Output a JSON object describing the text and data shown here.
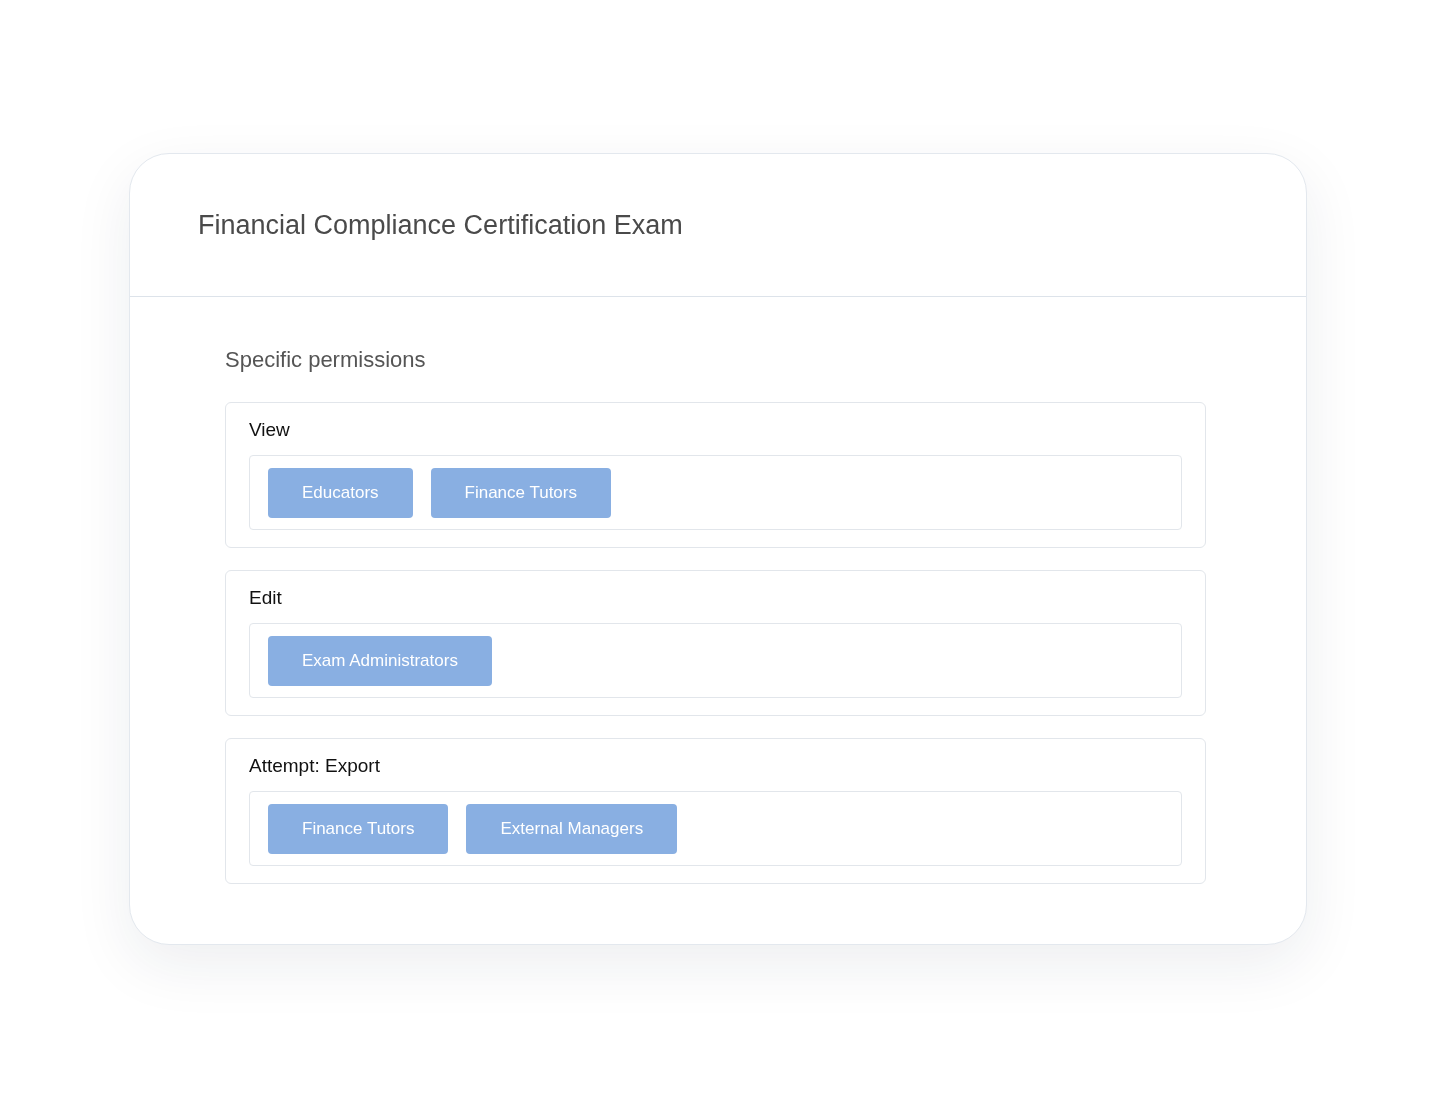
{
  "card": {
    "title": "Financial Compliance Certification Exam"
  },
  "permissions": {
    "heading": "Specific permissions",
    "groups": [
      {
        "label": "View",
        "tags": [
          "Educators",
          "Finance Tutors"
        ]
      },
      {
        "label": "Edit",
        "tags": [
          "Exam Administrators"
        ]
      },
      {
        "label": "Attempt: Export",
        "tags": [
          "Finance Tutors",
          "External Managers"
        ]
      }
    ]
  }
}
